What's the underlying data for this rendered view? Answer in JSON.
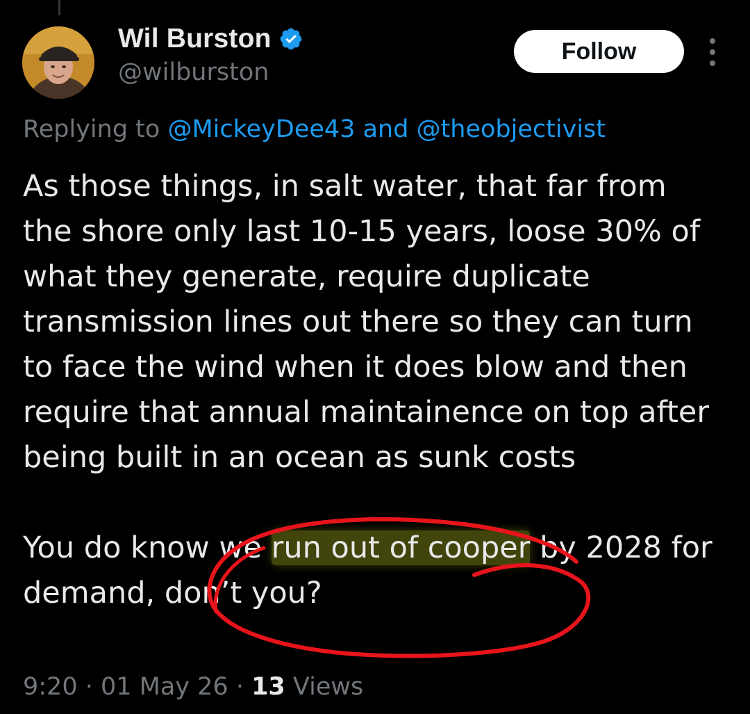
{
  "author": {
    "display_name": "Wil Burston",
    "handle": "@wilburston",
    "verified_icon": "verified-badge-icon",
    "verified_color": "#1d9bf0"
  },
  "actions": {
    "follow_label": "Follow",
    "more_icon": "more-vertical-icon"
  },
  "reply": {
    "prefix": "Replying to ",
    "mention_1": "@MickeyDee43",
    "joiner": " and ",
    "mention_2": "@theobjectivist"
  },
  "tweet": {
    "paragraph_1": "As those things, in salt water, that far from the shore only last 10-15 years, loose 30% of what they generate, require duplicate transmission lines out there so they can turn to face the wind when it does blow and then require that annual maintainence on top after being built in an ocean as sunk costs",
    "p2_before": "You do know we ",
    "p2_highlight": "run out of cooper",
    "p2_after": " by 2028 for demand, don’t you?"
  },
  "meta": {
    "time": "9:20",
    "sep_1": " · ",
    "date": "01 May 26",
    "sep_2": " · ",
    "views_count": "13",
    "views_label": " Views"
  },
  "colors": {
    "background": "#000000",
    "text_primary": "#e7e9ea",
    "text_secondary": "#71767b",
    "link": "#1d9bf0",
    "annotation_ink": "#e8141b",
    "highlight": "#6e7313"
  }
}
